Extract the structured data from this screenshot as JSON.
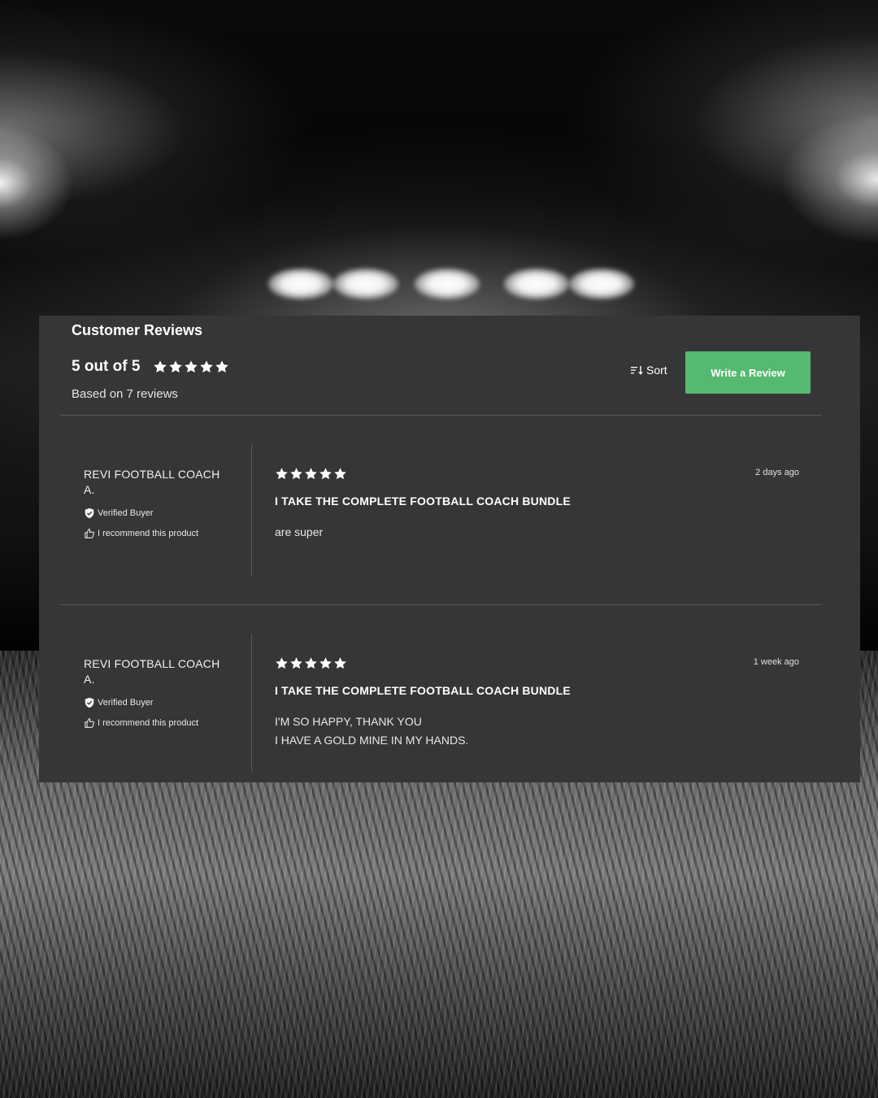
{
  "header": {
    "title": "Customer Reviews",
    "rating_text": "5 out of 5",
    "rating_value": 5,
    "based_on": "Based on 7 reviews",
    "sort_label": "Sort",
    "write_review_label": "Write a Review"
  },
  "reviews": [
    {
      "author_line1": "REVI FOOTBALL COACH",
      "author_line2": "A.",
      "verified_label": "Verified Buyer",
      "recommend_label": "I recommend this product",
      "rating": 5,
      "title": "I TAKE THE COMPLETE FOOTBALL COACH BUNDLE",
      "body_line1": "are super",
      "body_line2": "",
      "date": "2 days ago"
    },
    {
      "author_line1": "REVI FOOTBALL COACH",
      "author_line2": "A.",
      "verified_label": "Verified Buyer",
      "recommend_label": "I recommend this product",
      "rating": 5,
      "title": "I TAKE THE COMPLETE FOOTBALL COACH BUNDLE",
      "body_line1": "I'M SO HAPPY, THANK YOU",
      "body_line2": "I HAVE A GOLD MINE IN MY HANDS.",
      "date": "1 week ago"
    }
  ],
  "colors": {
    "panel_bg": "#363638",
    "accent_button": "#55b971",
    "text": "#ffffff",
    "divider": "#5a5a5c"
  },
  "icons": {
    "star": "star-icon",
    "sort": "sort-icon",
    "verified": "shield-check-icon",
    "recommend": "thumbs-up-icon"
  }
}
